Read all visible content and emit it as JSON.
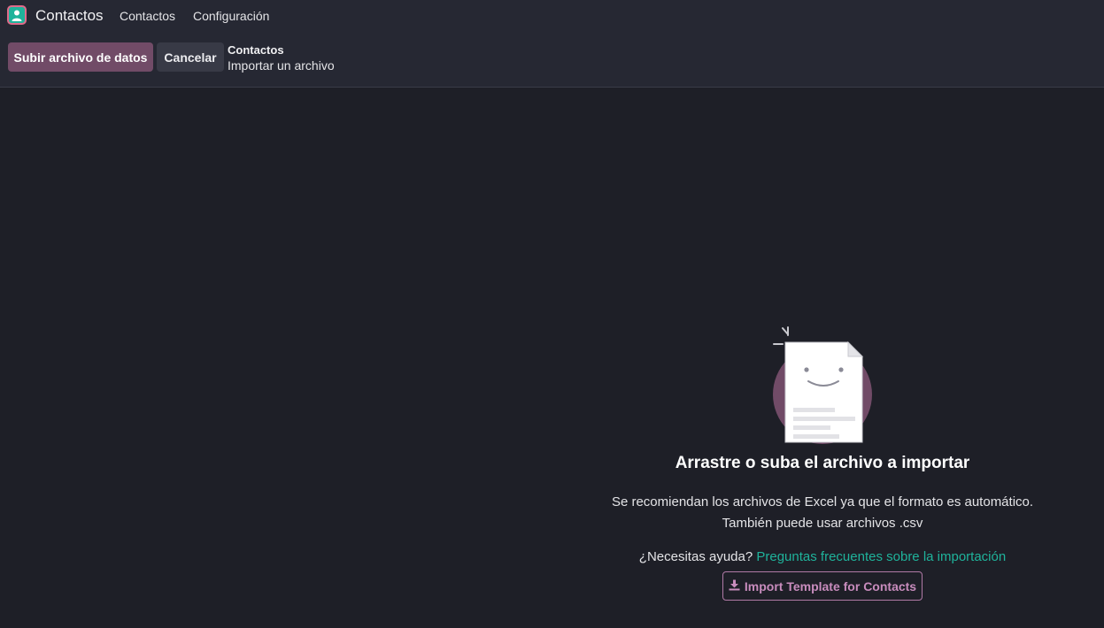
{
  "navbar": {
    "app_name": "Contactos",
    "menu": [
      {
        "label": "Contactos"
      },
      {
        "label": "Configuración"
      }
    ]
  },
  "control_panel": {
    "upload_label": "Subir archivo de datos",
    "cancel_label": "Cancelar",
    "breadcrumb_parent": "Contactos",
    "breadcrumb_current": "Importar un archivo"
  },
  "main": {
    "title": "Arrastre o suba el archivo a importar",
    "desc_line1": "Se recomiendan los archivos de Excel ya que el formato es automático.",
    "desc_line2": "También puede usar archivos .csv",
    "help_prefix": "¿Necesitas ayuda?",
    "help_link": "Preguntas frecuentes sobre la importación",
    "template_label": "Import Template for Contacts"
  },
  "icons": {
    "app_logo": "contacts-logo-icon",
    "download": "download-icon",
    "illustration": "smiling-document-icon"
  },
  "colors": {
    "primary": "#714b67",
    "link": "#1fb39b",
    "template_outline": "#b07aa6"
  }
}
